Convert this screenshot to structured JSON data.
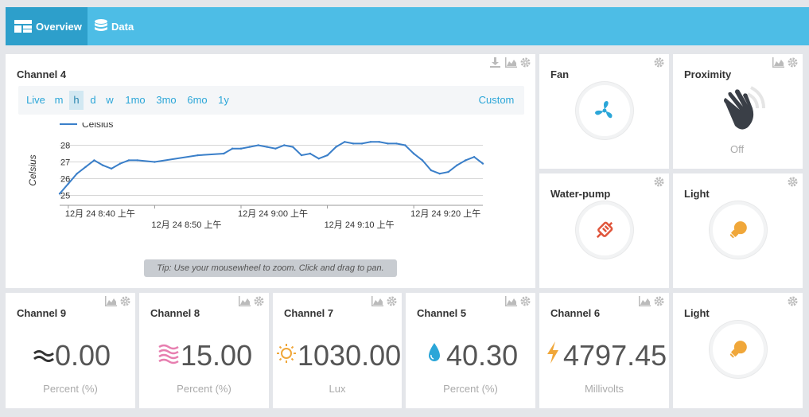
{
  "nav": {
    "tabs": [
      {
        "label": "Overview",
        "icon": "dashboard-icon",
        "active": true
      },
      {
        "label": "Data",
        "icon": "database-icon",
        "active": false
      }
    ]
  },
  "chart_card": {
    "title": "Channel 4",
    "range_buttons": [
      "Live",
      "m",
      "h",
      "d",
      "w",
      "1mo",
      "3mo",
      "6mo",
      "1y"
    ],
    "selected_range": "h",
    "custom_label": "Custom",
    "tip": "Tip: Use your mousewheel to zoom. Click and drag to pan."
  },
  "chart_data": {
    "type": "line",
    "title": "",
    "xlabel": "",
    "ylabel": "Celsius",
    "legend": [
      "Celsius"
    ],
    "legend_position": "top-left",
    "ylim": [
      24.5,
      28.5
    ],
    "yticks": [
      "25",
      "26",
      "27",
      "28"
    ],
    "xticks": [
      "12月 24 8:40 上午",
      "12月 24 8:50 上午",
      "12月 24 9:00 上午",
      "12月 24 9:10 上午",
      "12月 24 9:20 上午"
    ],
    "grid": true,
    "series": [
      {
        "name": "Celsius",
        "color": "#3a7fc9",
        "x": [
          "8:39",
          "8:40",
          "8:41",
          "8:42",
          "8:43",
          "8:44",
          "8:45",
          "8:46",
          "8:47",
          "8:48",
          "8:50",
          "8:55",
          "8:58",
          "8:59",
          "9:00",
          "9:01",
          "9:02",
          "9:03",
          "9:04",
          "9:05",
          "9:06",
          "9:07",
          "9:08",
          "9:09",
          "9:10",
          "9:11",
          "9:12",
          "9:13",
          "9:14",
          "9:15",
          "9:16",
          "9:17",
          "9:18",
          "9:19",
          "9:20",
          "9:21",
          "9:22",
          "9:23",
          "9:24",
          "9:25",
          "9:26",
          "9:27",
          "9:28"
        ],
        "values": [
          25.1,
          25.7,
          26.3,
          26.7,
          27.1,
          26.8,
          26.6,
          26.9,
          27.1,
          27.1,
          27.0,
          27.4,
          27.5,
          27.8,
          27.8,
          27.9,
          28.0,
          27.9,
          27.8,
          28.0,
          27.9,
          27.4,
          27.5,
          27.2,
          27.4,
          27.9,
          28.2,
          28.1,
          28.1,
          28.2,
          28.2,
          28.1,
          28.1,
          28.0,
          27.5,
          27.1,
          26.5,
          26.3,
          26.4,
          26.8,
          27.1,
          27.3,
          26.9
        ]
      }
    ]
  },
  "toggles": {
    "fan": {
      "title": "Fan",
      "icon": "fan-icon",
      "color": "#2ba6d8"
    },
    "proximity": {
      "title": "Proximity",
      "icon": "waving-hand-icon",
      "state": "Off"
    },
    "water_pump": {
      "title": "Water-pump",
      "icon": "pump-icon",
      "color": "#e0553b"
    },
    "light1": {
      "title": "Light",
      "icon": "lightbulb-icon",
      "color": "#f0a73a"
    },
    "light2": {
      "title": "Light",
      "icon": "lightbulb-icon",
      "color": "#f0a73a"
    }
  },
  "values": [
    {
      "title": "Channel 9",
      "value": "0.00",
      "unit": "Percent (%)",
      "icon": "wind-icon",
      "color": "#333333"
    },
    {
      "title": "Channel 8",
      "value": "15.00",
      "unit": "Percent (%)",
      "icon": "humidity-waves-icon",
      "color": "#e77fb0"
    },
    {
      "title": "Channel 7",
      "value": "1030.00",
      "unit": "Lux",
      "icon": "sun-icon",
      "color": "#f0a73a"
    },
    {
      "title": "Channel 5",
      "value": "40.30",
      "unit": "Percent (%)",
      "icon": "water-drop-icon",
      "color": "#2ba6d8"
    },
    {
      "title": "Channel 6",
      "value": "4797.45",
      "unit": "Millivolts",
      "icon": "lightning-icon",
      "color": "#f0a73a"
    }
  ]
}
